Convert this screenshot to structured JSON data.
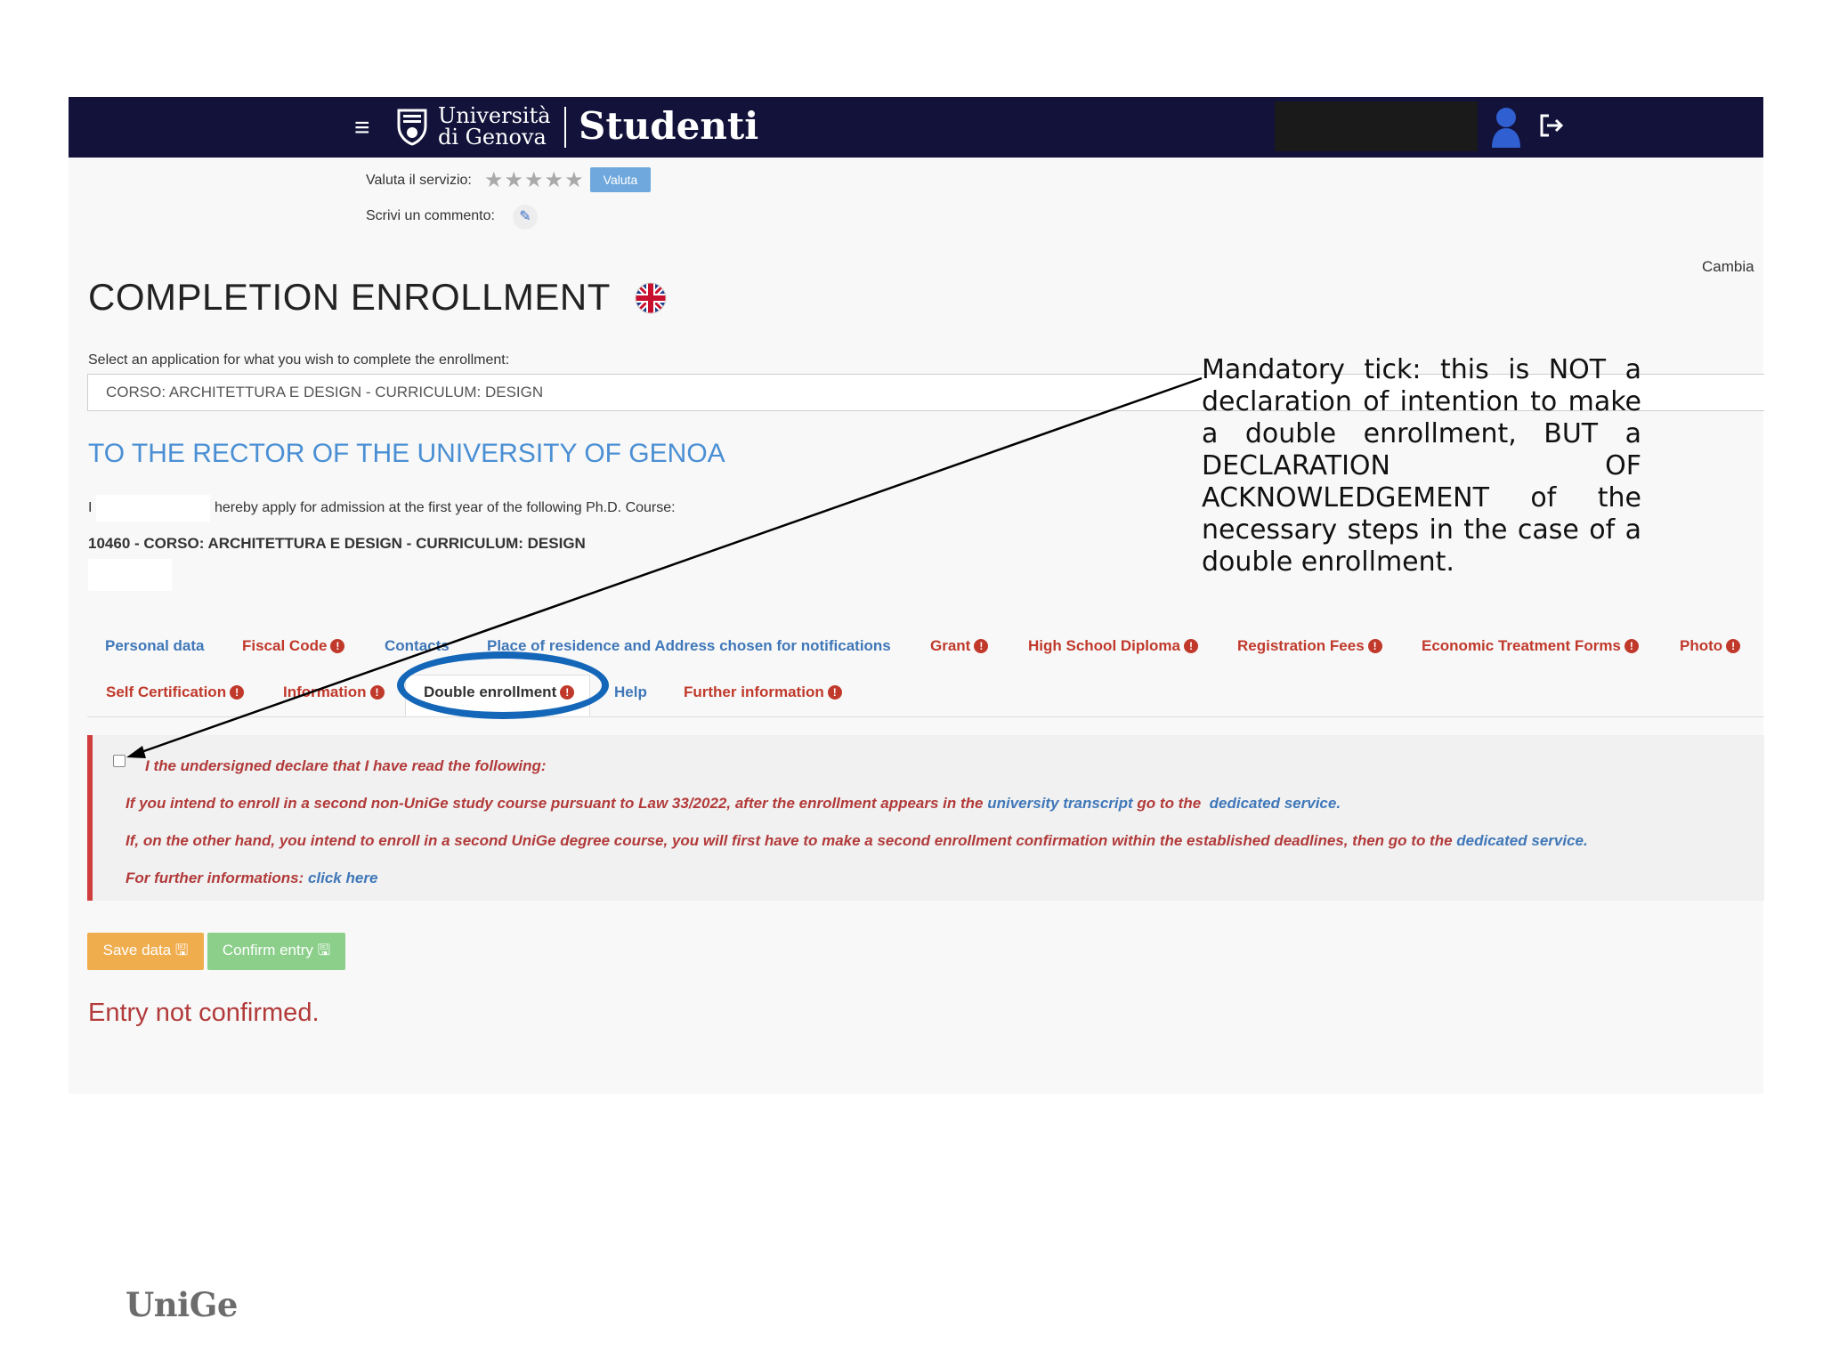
{
  "header": {
    "university_line1": "Università",
    "university_line2": "di Genova",
    "app_name": "Studenti"
  },
  "rating": {
    "label": "Valuta il servizio:",
    "stars": "★★★★★",
    "button_label": "Valuta",
    "comment_label": "Scrivi un commento:"
  },
  "cambia": "Cambia",
  "page": {
    "title": "COMPLETION ENROLLMENT",
    "select_label": "Select an application for what you wish to complete the enrollment:",
    "select_value": "CORSO: ARCHITETTURA E DESIGN - CURRICULUM: DESIGN",
    "rector_heading": "TO THE RECTOR OF THE UNIVERSITY OF GENOA",
    "apply_prefix": "I",
    "apply_text": "hereby apply for admission at the first year of the following Ph.D. Course:",
    "course": "10460 - CORSO: ARCHITETTURA E DESIGN - CURRICULUM: DESIGN"
  },
  "tabs": {
    "row1": [
      "Personal data",
      "Fiscal Code",
      "Contacts",
      "Place of residence and Address chosen for notifications",
      "Grant",
      "High School Diploma",
      "Registration Fees",
      "Economic Treatment Forms",
      "Photo"
    ],
    "row2": [
      "Self Certification",
      "Information",
      "Double enrollment",
      "Help",
      "Further information"
    ],
    "warning_mark": "!"
  },
  "alert": {
    "declare": "I the undersigned declare that I have read the following:",
    "line1_pre": "If you intend to enroll in a second non-UniGe study course pursuant to Law 33/2022, after the enrollment appears in the",
    "line1_link1": "university transcript",
    "line1_mid": "go to the",
    "line1_link2": "dedicated service.",
    "line2_pre": "If, on the other hand, you intend to enroll in a second UniGe degree course, you will first have to make a second enrollment confirmation within the established deadlines, then go to the",
    "line2_link": "dedicated service.",
    "line3_pre": "For further informations:",
    "line3_link": "click here"
  },
  "buttons": {
    "save": "Save data",
    "confirm": "Confirm entry"
  },
  "status": "Entry not confirmed.",
  "annotation": "Mandatory tick: this is NOT a declaration of intention to make a double enrollment, BUT a DECLARATION OF ACKNOWLEDGEMENT of the necessary steps in the case of a double enrollment.",
  "footer_logo": "UniGe",
  "colors": {
    "topbar": "#12123b",
    "link_blue": "#3f77b8",
    "warning_red": "#c0392b",
    "save_orange": "#f0ad4e",
    "confirm_green": "#8bcf8a",
    "highlight_blue": "#1467b8"
  },
  "icons": [
    "menu-icon",
    "university-shield-icon",
    "user-icon",
    "logout-icon",
    "pencil-icon",
    "uk-flag-icon",
    "floppy-disk-icon",
    "exclamation-icon"
  ]
}
